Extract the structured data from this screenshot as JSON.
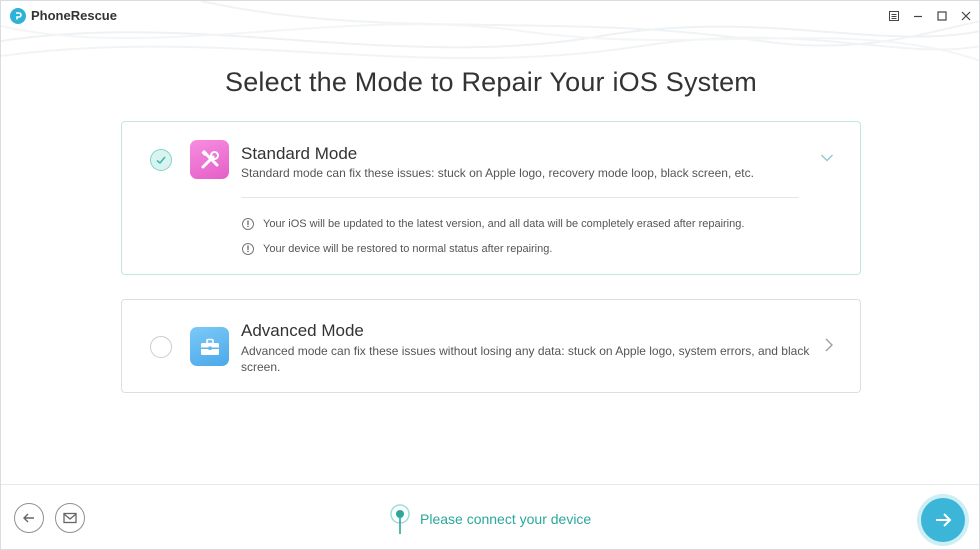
{
  "app": {
    "name": "PhoneRescue",
    "logo_letter": "P"
  },
  "window_controls": {
    "menu_icon": "menu-icon",
    "minimize_icon": "minimize-icon",
    "maximize_icon": "maximize-icon",
    "close_icon": "close-icon"
  },
  "page": {
    "title": "Select the Mode to Repair Your iOS System"
  },
  "modes": [
    {
      "id": "standard",
      "title": "Standard Mode",
      "description": "Standard mode can fix these issues: stuck on Apple logo, recovery mode loop, black screen, etc.",
      "selected": true,
      "expanded": true,
      "icon": "tools-icon",
      "notes": [
        "Your iOS will be updated to the latest version, and all data will be completely erased after repairing.",
        "Your device will be restored to normal status after repairing."
      ]
    },
    {
      "id": "advanced",
      "title": "Advanced Mode",
      "description": "Advanced mode can fix these issues without losing any data: stuck on Apple logo, system errors, and black screen.",
      "selected": false,
      "expanded": false,
      "icon": "toolbox-icon"
    }
  ],
  "footer": {
    "status_text": "Please connect your device"
  },
  "colors": {
    "accent": "#3bb6d8",
    "teal_text": "#2aa89b",
    "selected_border": "#bfe7e4",
    "standard_icon": "#ec72d4",
    "advanced_icon": "#5db4ee"
  }
}
